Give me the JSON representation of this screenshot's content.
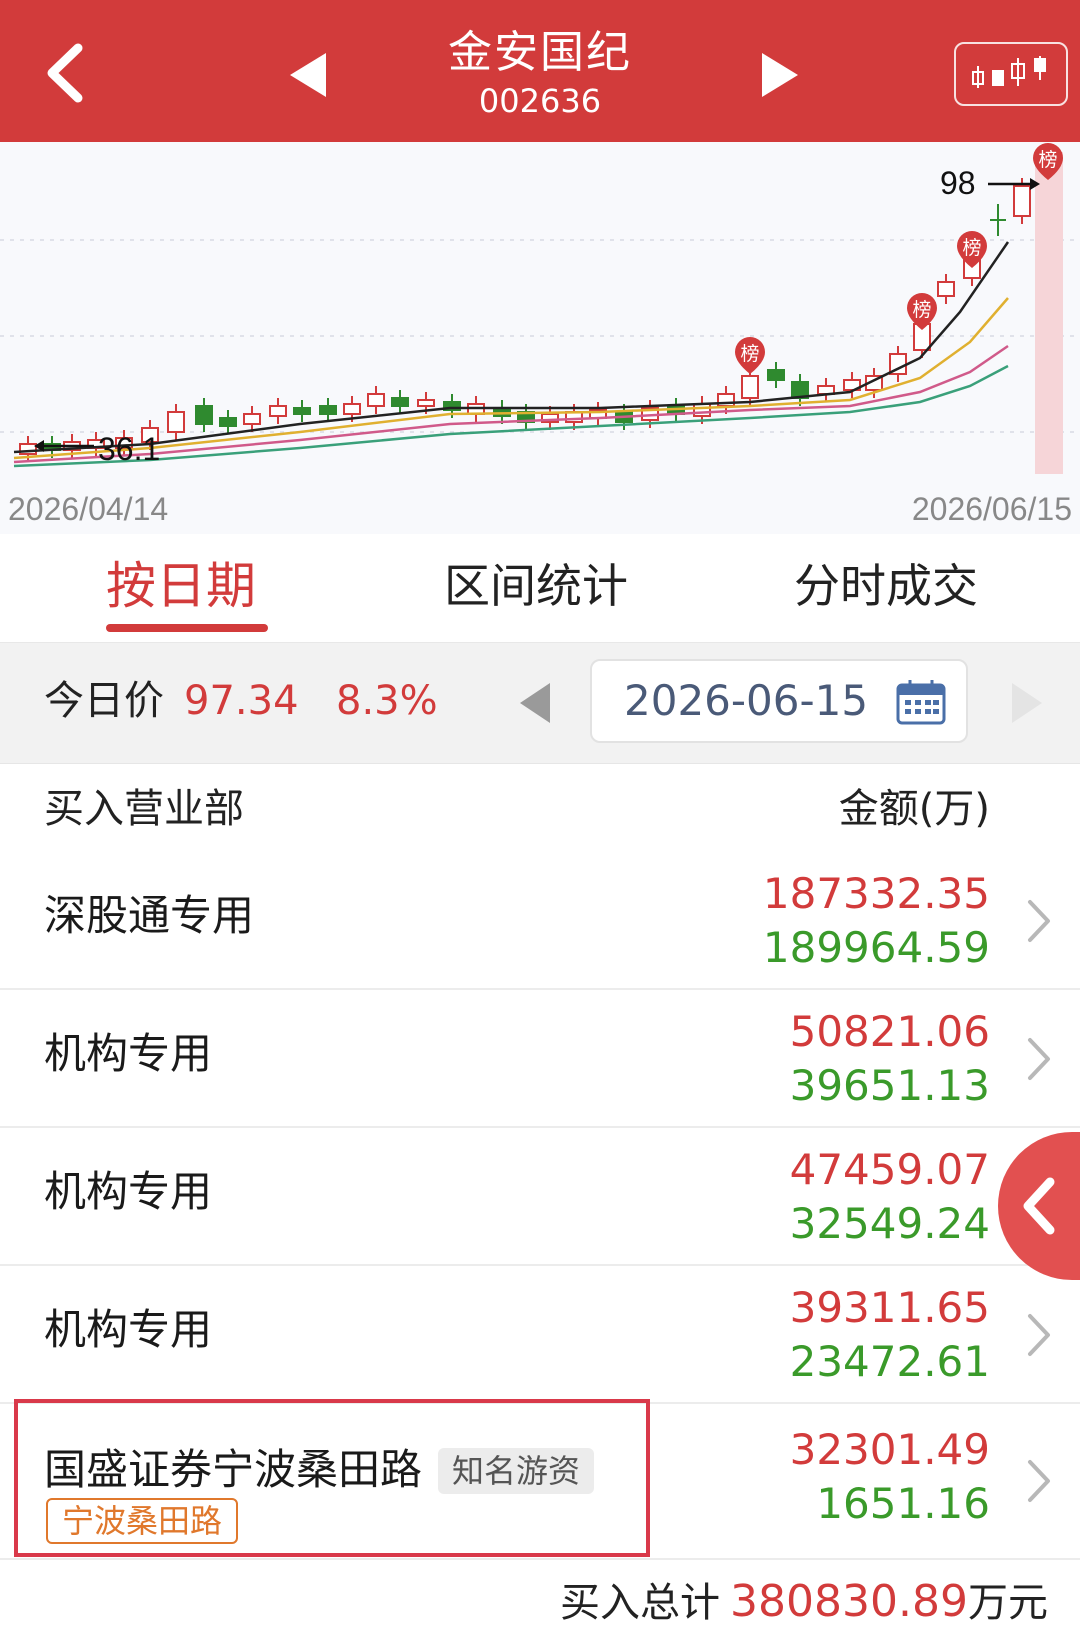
{
  "header": {
    "title": "金安国纪",
    "code": "002636",
    "icons": {
      "back": "back-chevron-icon",
      "prev": "prev-triangle-icon",
      "next": "next-triangle-icon",
      "kline": "kline-chart-icon"
    }
  },
  "chart_data": {
    "type": "candlestick",
    "start_date": "2026/04/14",
    "end_date": "2026/06/15",
    "low_marker": "36.1",
    "high_marker": "98",
    "badge_label": "榜",
    "colors": {
      "up": "#d23b3b",
      "down": "#2f8a2f",
      "ma5": "#222222",
      "ma10": "#e0b030",
      "ma20": "#d05a8a",
      "ma30": "#3aa07a"
    },
    "grid": true
  },
  "tabs": [
    {
      "label": "按日期",
      "active": true
    },
    {
      "label": "区间统计",
      "active": false
    },
    {
      "label": "分时成交",
      "active": false
    }
  ],
  "price_bar": {
    "label": "今日价",
    "price": "97.34",
    "change_pct": "8.3%",
    "date": "2026-06-15",
    "calendar_icon": "calendar-icon"
  },
  "list": {
    "header_left": "买入营业部",
    "header_right": "金额(万)",
    "rows": [
      {
        "name": "深股通专用",
        "buy": "187332.35",
        "sell": "189964.59"
      },
      {
        "name": "机构专用",
        "buy": "50821.06",
        "sell": "39651.13"
      },
      {
        "name": "机构专用",
        "buy": "47459.07",
        "sell": "32549.24"
      },
      {
        "name": "机构专用",
        "buy": "39311.65",
        "sell": "23472.61"
      },
      {
        "name": "国盛证券宁波桑田路",
        "tag": "知名游资",
        "sub_tag": "宁波桑田路",
        "buy": "32301.49",
        "sell": "1651.16"
      }
    ]
  },
  "footer": {
    "label": "买入总计",
    "value": "380830.89",
    "unit": "万元"
  },
  "colors": {
    "brand_red": "#d23b3b",
    "up_red": "#d23b3b",
    "down_green": "#3a9a2a",
    "tag_orange": "#e0782c"
  }
}
